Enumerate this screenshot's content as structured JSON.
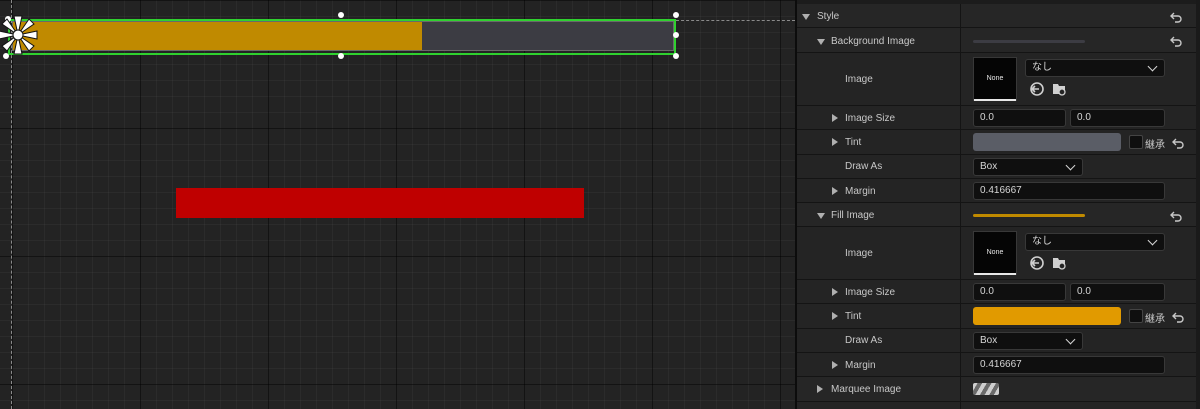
{
  "canvas": {
    "progress_percent": 62,
    "fill_color": "#c08a00",
    "bg_color": "#3c3c43",
    "selection_color": "#2fd12f",
    "red_bar_color": "#bf0000"
  },
  "details": {
    "style": {
      "label": "Style"
    },
    "background_image": {
      "label": "Background Image",
      "image": {
        "label": "Image",
        "thumb": "None",
        "dropdown": "なし"
      },
      "image_size": {
        "label": "Image Size",
        "x": "0.0",
        "y": "0.0"
      },
      "tint": {
        "label": "Tint",
        "color": "#5a5d66",
        "inherit_label": "継承"
      },
      "draw_as": {
        "label": "Draw As",
        "value": "Box"
      },
      "margin": {
        "label": "Margin",
        "value": "0.416667"
      }
    },
    "fill_image": {
      "label": "Fill Image",
      "image": {
        "label": "Image",
        "thumb": "None",
        "dropdown": "なし"
      },
      "image_size": {
        "label": "Image Size",
        "x": "0.0",
        "y": "0.0"
      },
      "tint": {
        "label": "Tint",
        "color": "#e19a00",
        "inherit_label": "継承"
      },
      "draw_as": {
        "label": "Draw As",
        "value": "Box"
      },
      "margin": {
        "label": "Margin",
        "value": "0.416667"
      }
    },
    "marquee_image": {
      "label": "Marquee Image"
    }
  },
  "icons": {
    "reset": "reset-arrow-icon",
    "use_asset": "use-selected-asset-icon",
    "browse": "browse-folder-icon",
    "anchor": "anchor-icon"
  }
}
